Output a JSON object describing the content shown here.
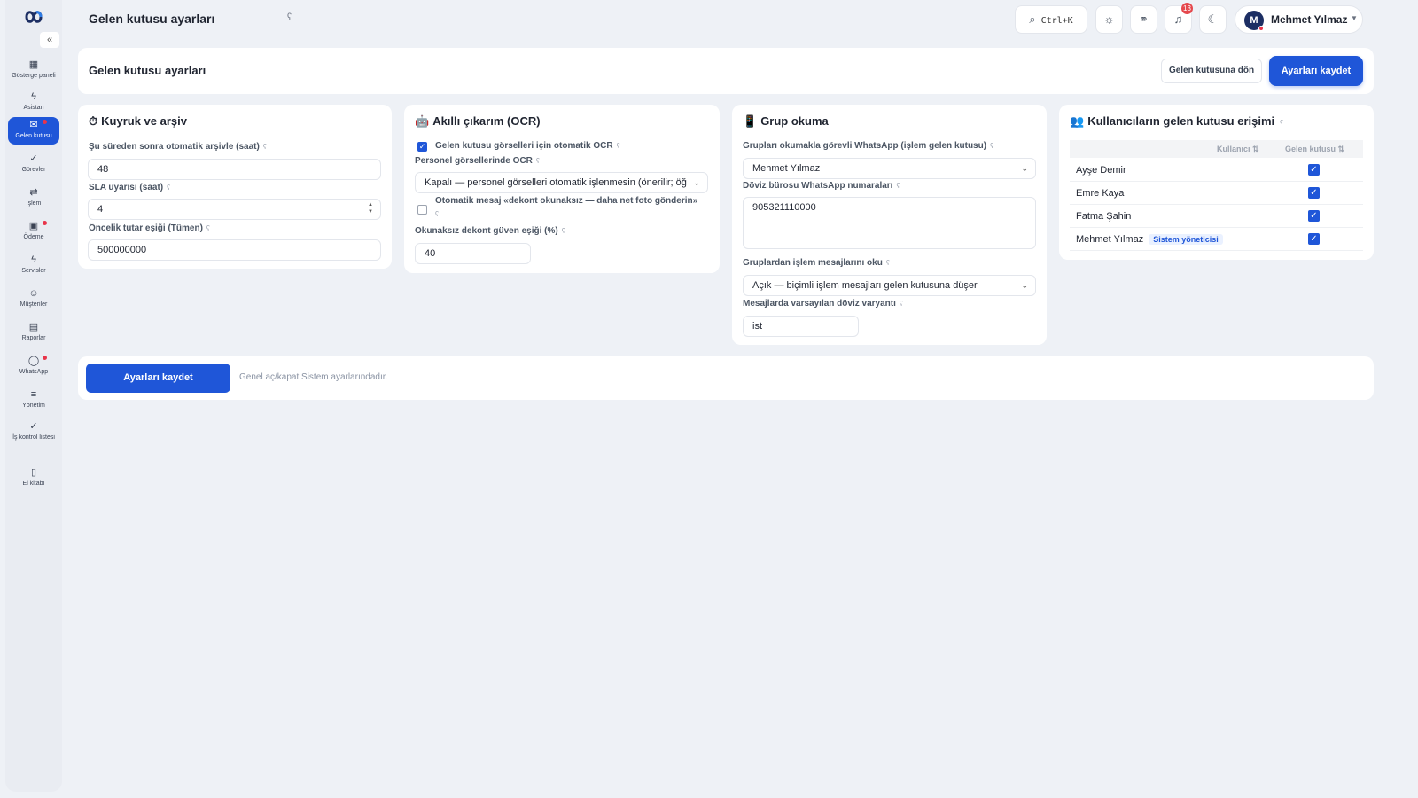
{
  "app": {
    "logo": "infinity-logo"
  },
  "sidebar": {
    "collapse_label": "«",
    "items": [
      {
        "label": "Gösterge paneli",
        "icon": "dashboard-icon",
        "glyph": "▦",
        "active": false,
        "dot": false
      },
      {
        "label": "Asistan",
        "icon": "bolt-icon",
        "glyph": "ϟ",
        "active": false,
        "dot": false
      },
      {
        "label": "Gelen kutusu",
        "icon": "inbox-icon",
        "glyph": "✉",
        "active": true,
        "dot": true
      },
      {
        "label": "Görevler",
        "icon": "check-icon",
        "glyph": "✓",
        "active": false,
        "dot": false
      },
      {
        "label": "İşlem",
        "icon": "swap-icon",
        "glyph": "⇄",
        "active": false,
        "dot": false
      },
      {
        "label": "Ödeme",
        "icon": "payment-icon",
        "glyph": "▣",
        "active": false,
        "dot": true
      },
      {
        "label": "Servisler",
        "icon": "bolt-icon",
        "glyph": "ϟ",
        "active": false,
        "dot": false
      },
      {
        "label": "Müşteriler",
        "icon": "users-icon",
        "glyph": "☺",
        "active": false,
        "dot": false
      },
      {
        "label": "Raporlar",
        "icon": "report-icon",
        "glyph": "▤",
        "active": false,
        "dot": false
      },
      {
        "label": "WhatsApp",
        "icon": "chat-icon",
        "glyph": "◯",
        "active": false,
        "dot": true
      },
      {
        "label": "Yönetim",
        "icon": "sliders-icon",
        "glyph": "≡",
        "active": false,
        "dot": false
      },
      {
        "label": "İş kontrol listesi",
        "icon": "check-icon",
        "glyph": "✓",
        "active": false,
        "dot": false
      },
      {
        "label": "El kitabı",
        "icon": "book-icon",
        "glyph": "▯",
        "active": false,
        "dot": false
      }
    ]
  },
  "topbar": {
    "title": "Gelen kutusu ayarları",
    "title_info": "ʕ",
    "search_shortcut": "Ctrl+K",
    "notifications_count": "13",
    "user": {
      "initial": "M",
      "name": "Mehmet Yılmaz"
    }
  },
  "header": {
    "title": "Gelen kutusu ayarları",
    "back_button": "Gelen kutusuna dön",
    "save_button": "Ayarları kaydet"
  },
  "queue_card": {
    "emoji": "⏱",
    "title": "Kuyruk ve arşiv",
    "archive_label": "Şu süreden sonra otomatik arşivle (saat)",
    "archive_value": "48",
    "sla_label": "SLA uyarısı (saat)",
    "sla_value": "4",
    "priority_label": "Öncelik tutar eşiği (Tümen)",
    "priority_value": "500000000"
  },
  "ocr_card": {
    "emoji": "🤖",
    "title": "Akıllı çıkarım (OCR)",
    "auto_ocr_label": "Gelen kutusu görselleri için otomatik OCR",
    "auto_ocr_checked": true,
    "staff_ocr_label": "Personel görsellerinde OCR",
    "staff_ocr_value": "Kapalı — personel görselleri otomatik işlenmesin (önerilir; öğ",
    "auto_msg_label": "Otomatik mesaj «dekont okunaksız — daha net foto gönderin»",
    "auto_msg_checked": false,
    "threshold_label": "Okunaksız dekont güven eşiği (%)",
    "threshold_value": "40"
  },
  "group_card": {
    "emoji": "📱",
    "title": "Grup okuma",
    "whatsapp_label": "Grupları okumakla görevli WhatsApp (işlem gelen kutusu)",
    "whatsapp_value": "Mehmet Yılmaz",
    "numbers_label": "Döviz bürosu WhatsApp numaraları",
    "numbers_value": "905321110000",
    "read_msgs_label": "Gruplardan işlem mesajlarını oku",
    "read_msgs_value": "Açık — biçimli işlem mesajları gelen kutusuna düşer",
    "variant_label": "Mesajlarda varsayılan döviz varyantı",
    "variant_value": "ist"
  },
  "access_card": {
    "emoji": "👥",
    "title": "Kullanıcıların gelen kutusu erişimi",
    "col_user": "Kullanıcı ⇅",
    "col_inbox": "Gelen kutusu ⇅",
    "rows": [
      {
        "name": "Ayşe Demir",
        "role": "",
        "checked": true
      },
      {
        "name": "Emre Kaya",
        "role": "",
        "checked": true
      },
      {
        "name": "Fatma Şahin",
        "role": "",
        "checked": true
      },
      {
        "name": "Mehmet Yılmaz",
        "role": "Sistem yöneticisi",
        "checked": true
      }
    ]
  },
  "footer": {
    "save_button": "Ayarları kaydet",
    "note": "Genel aç/kapat Sistem ayarlarındadır."
  },
  "colors": {
    "primary": "#1f56d8",
    "background": "#eef1f6",
    "badge": "#e5484d"
  }
}
